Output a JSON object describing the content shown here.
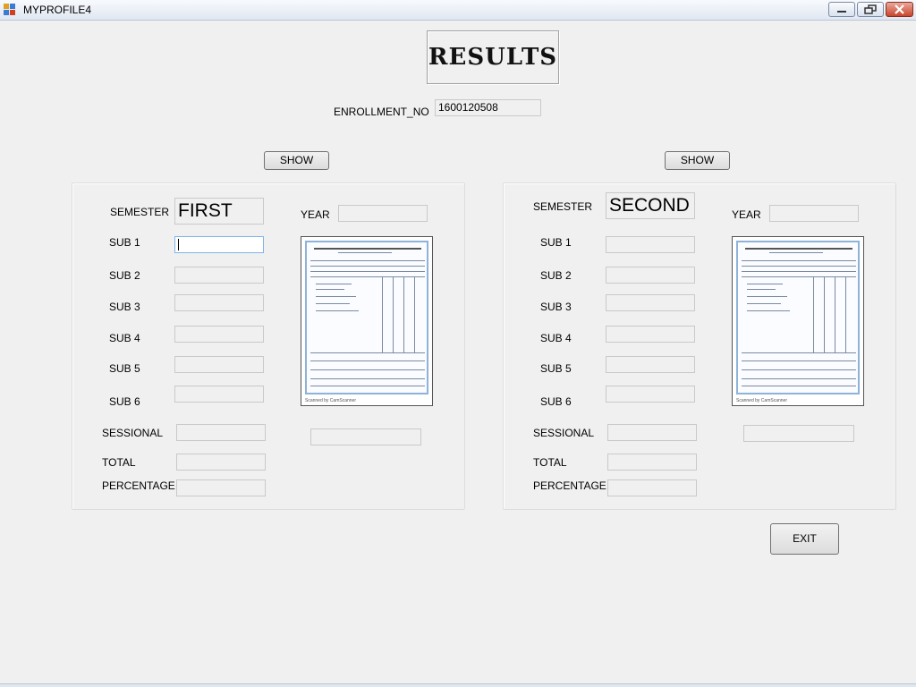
{
  "window": {
    "title": "MYPROFILE4"
  },
  "header": {
    "title": "RESULTS"
  },
  "enrollment": {
    "label": "ENROLLMENT_NO",
    "value": "1600120508"
  },
  "panels": [
    {
      "show_label": "SHOW",
      "semester_label": "SEMESTER",
      "semester_value": "FIRST",
      "year_label": "YEAR",
      "year_value": "",
      "subjects": [
        {
          "label": "SUB 1",
          "value": ""
        },
        {
          "label": "SUB 2",
          "value": ""
        },
        {
          "label": "SUB 3",
          "value": ""
        },
        {
          "label": "SUB 4",
          "value": ""
        },
        {
          "label": "SUB 5",
          "value": ""
        },
        {
          "label": "SUB 6",
          "value": ""
        }
      ],
      "sessional_label": "SESSIONAL",
      "sessional_value": "",
      "total_label": "TOTAL",
      "total_value": "",
      "percentage_label": "PERCENTAGE",
      "percentage_value": "",
      "result_value": ""
    },
    {
      "show_label": "SHOW",
      "semester_label": "SEMESTER",
      "semester_value": "SECOND",
      "year_label": "YEAR",
      "year_value": "",
      "subjects": [
        {
          "label": "SUB 1",
          "value": ""
        },
        {
          "label": "SUB 2",
          "value": ""
        },
        {
          "label": "SUB 3",
          "value": ""
        },
        {
          "label": "SUB 4",
          "value": ""
        },
        {
          "label": "SUB 5",
          "value": ""
        },
        {
          "label": "SUB 6",
          "value": ""
        }
      ],
      "sessional_label": "SESSIONAL",
      "sessional_value": "",
      "total_label": "TOTAL",
      "total_value": "",
      "percentage_label": "PERCENTAGE",
      "percentage_value": "",
      "result_value": ""
    }
  ],
  "exit_label": "EXIT",
  "icons": {
    "app": "app-icon",
    "minimize": "minimize-icon",
    "maximize": "restore-icon",
    "close": "close-icon",
    "marksheet": "marksheet-image"
  },
  "colors": {
    "window_bg": "#f0f0f0",
    "close_button": "#c8452c",
    "active_field_border": "#7eb4ea"
  }
}
